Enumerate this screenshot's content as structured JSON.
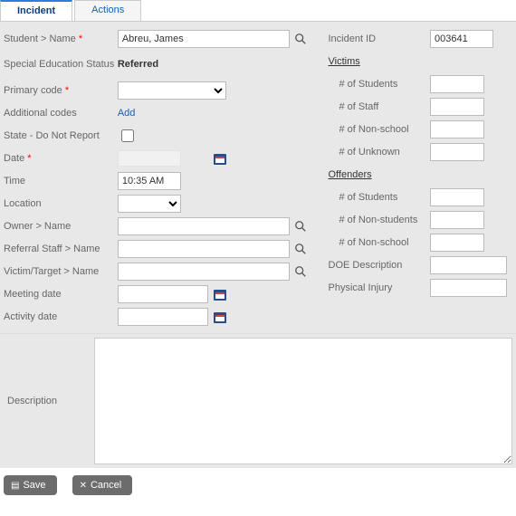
{
  "tabs": {
    "incident": "Incident",
    "actions": "Actions"
  },
  "left": {
    "studentName": "Student > Name",
    "studentNameValue": "Abreu, James",
    "specialEd": "Special Education Status",
    "referred": "Referred",
    "primaryCode": "Primary code",
    "additionalCodes": "Additional codes",
    "addLink": "Add",
    "stateDNR": "State - Do Not Report",
    "date": "Date",
    "time": "Time",
    "timeValue": "10:35 AM",
    "location": "Location",
    "ownerName": "Owner > Name",
    "referralStaff": "Referral Staff > Name",
    "victimTarget": "Victim/Target > Name",
    "meetingDate": "Meeting date",
    "activityDate": "Activity date"
  },
  "right": {
    "incidentId": "Incident ID",
    "incidentIdValue": "003641",
    "victims": "Victims",
    "numStudents": "# of Students",
    "numStaff": "# of Staff",
    "numNonSchool": "# of Non-school",
    "numUnknown": "# of Unknown",
    "offenders": "Offenders",
    "offNumStudents": "# of Students",
    "offNumNonStudents": "# of Non-students",
    "offNumNonSchool": "# of Non-school",
    "doeDescription": "DOE Description",
    "physicalInjury": "Physical Injury"
  },
  "desc": {
    "label": "Description"
  },
  "footer": {
    "save": "Save",
    "cancel": "Cancel"
  }
}
